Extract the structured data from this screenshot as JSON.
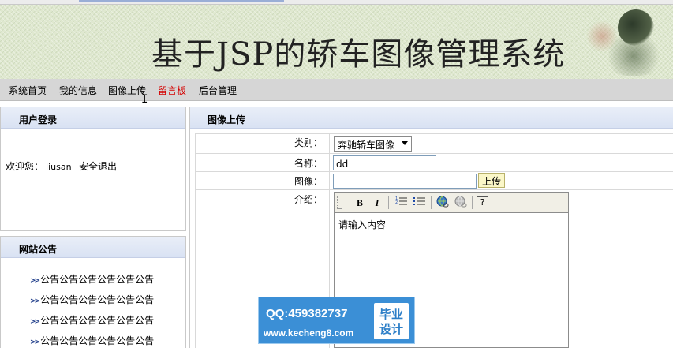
{
  "header": {
    "site_title": "基于JSP的轿车图像管理系统"
  },
  "nav": {
    "items": [
      {
        "label": "系统首页",
        "active": false
      },
      {
        "label": "我的信息",
        "active": false
      },
      {
        "label": "图像上传",
        "active": false
      },
      {
        "label": "留言板",
        "active": true
      },
      {
        "label": "后台管理",
        "active": false
      }
    ]
  },
  "login_panel": {
    "title": "用户登录",
    "welcome_label": "欢迎您：",
    "username": "liusan",
    "logout_label": "安全退出"
  },
  "notice_panel": {
    "title": "网站公告",
    "items": [
      "公告公告公告公告公告公告",
      "公告公告公告公告公告公告",
      "公告公告公告公告公告公告",
      "公告公告公告公告公告公告"
    ]
  },
  "upload_panel": {
    "title": "图像上传",
    "category_label": "类别：",
    "category_value": "奔驰轿车图像",
    "name_label": "名称：",
    "name_value": "dd",
    "image_label": "图像：",
    "upload_button": "上传",
    "intro_label": "介绍：",
    "editor_content": "请输入内容"
  },
  "editor_toolbar": {
    "bold": "B",
    "italic": "I",
    "help": "?"
  },
  "watermark": {
    "qq": "QQ:459382737",
    "url": "www.kecheng8.com",
    "badge_line1": "毕业",
    "badge_line2": "设计"
  },
  "colors": {
    "nav_active": "#d40000",
    "panel_header": "#d9e2f3",
    "watermark_bg": "#3b8fd6"
  }
}
